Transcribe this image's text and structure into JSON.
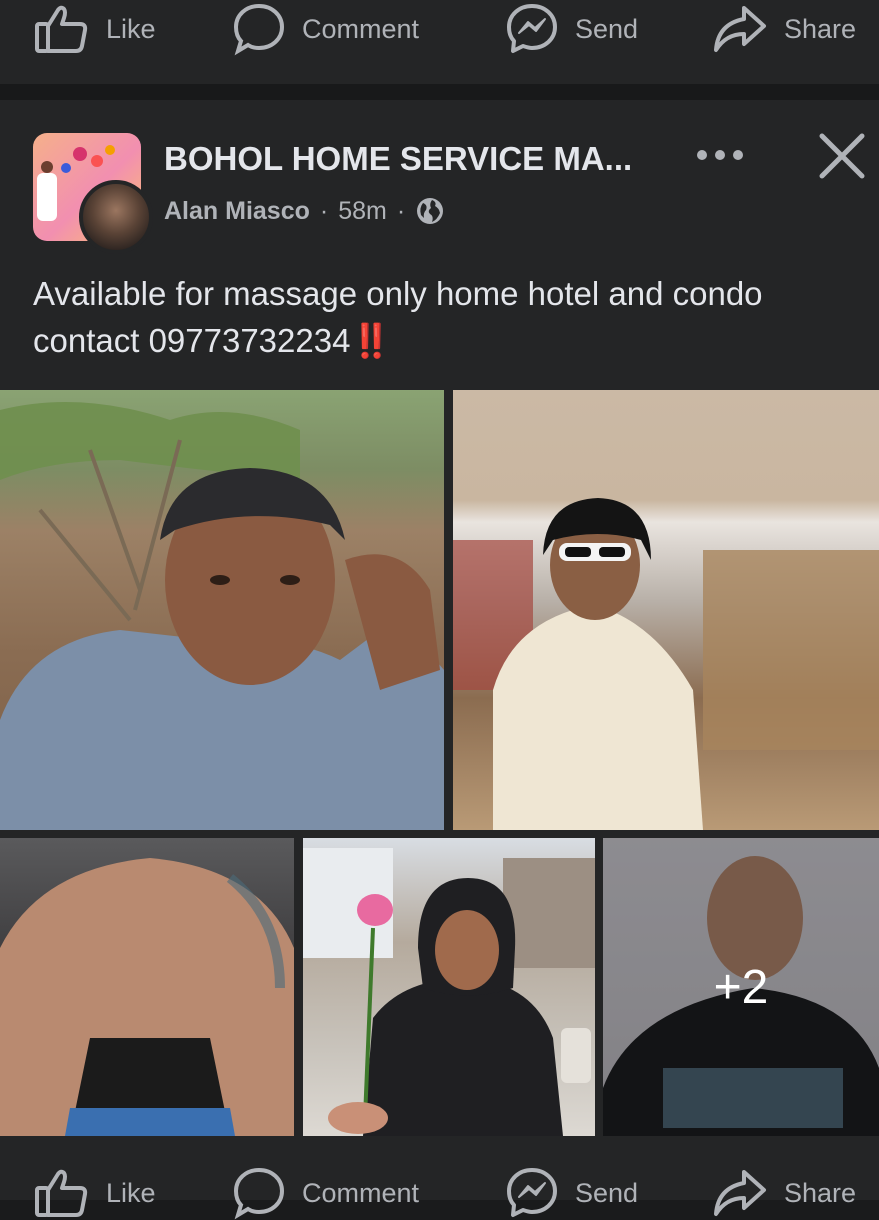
{
  "actions": {
    "like": "Like",
    "comment": "Comment",
    "send": "Send",
    "share": "Share"
  },
  "post": {
    "group_name": "BOHOL HOME SERVICE MA...",
    "author": "Alan Miasco",
    "separator": "·",
    "time": "58m",
    "audience_icon": "globe-icon",
    "text_line1": "Available for massage only home hotel and condo",
    "text_line2": "contact 09773732234",
    "emphasis": "‼️",
    "more_photos": "+2"
  },
  "colors": {
    "background": "#18191a",
    "card": "#242526",
    "text": "#e4e6eb",
    "secondary_text": "#b0b3b8",
    "emphasis_red": "#f02849"
  }
}
